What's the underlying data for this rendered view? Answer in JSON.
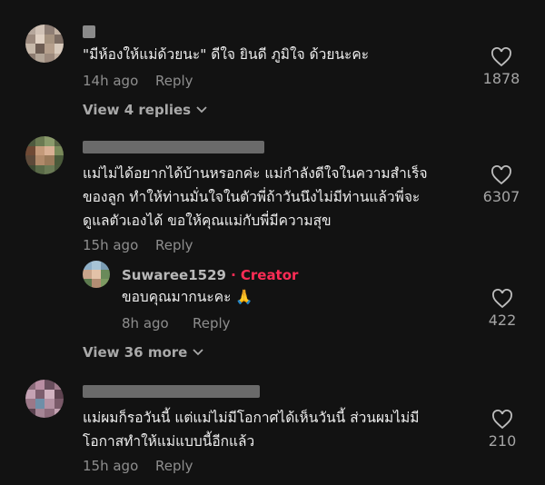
{
  "comments": [
    {
      "text_lines": [
        "\"มีห้องให้แม่ด้วยนะ\" ดีใจ ยินดี ภูมิใจ ด้วยนะคะ"
      ],
      "time": "14h ago",
      "reply_label": "Reply",
      "likes": "1878",
      "view_replies": "View 4 replies"
    },
    {
      "text_lines": [
        "แม่ไม่ได้อยากได้บ้านหรอกค่ะ แม่กำลังดีใจในความสำเร็จ",
        "ของลูก ทำให้ท่านมั่นใจในตัวพี่ถ้าวันนึงไม่มีท่านแล้วพี่จะ",
        "ดูแลตัวเองได้ ขอให้คุณแม่กับพี่มีความสุข"
      ],
      "time": "15h ago",
      "reply_label": "Reply",
      "likes": "6307",
      "reply": {
        "username": "Suwaree1529",
        "separator": "·",
        "badge": "Creator",
        "text": "ขอบคุณมากนะคะ 🙏",
        "time": "8h ago",
        "reply_label": "Reply",
        "likes": "422"
      },
      "view_more": "View 36 more"
    },
    {
      "text_lines": [
        "แม่ผมก็รอวันนี้ แต่แม่ไม่มีโอกาศได้เห็นวันนี้ ส่วนผมไม่มี",
        "โอกาสทำให้แม่แบบนี้อีกแล้ว"
      ],
      "time": "15h ago",
      "reply_label": "Reply",
      "likes": "210"
    }
  ],
  "colors": {
    "background": "#121212",
    "creator_badge": "#fe2c55",
    "secondary_text": "#8e8e8e"
  },
  "icons": {
    "like": "heart-outline-icon",
    "expand": "chevron-down-icon",
    "prayer_emoji": "🙏"
  }
}
